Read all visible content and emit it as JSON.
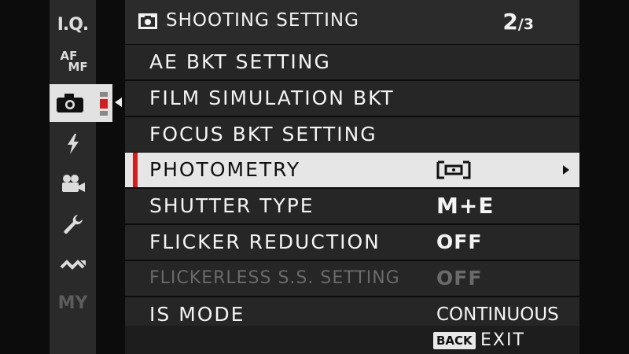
{
  "sidebar": {
    "items": [
      {
        "name": "image-quality",
        "label": "I.Q."
      },
      {
        "name": "af-mf",
        "label_top": "AF",
        "label_bottom": "MF"
      },
      {
        "name": "shooting-setting",
        "icon": "camera-icon",
        "selected": true
      },
      {
        "name": "flash",
        "icon": "flash-icon"
      },
      {
        "name": "movie",
        "icon": "movie-camera-icon"
      },
      {
        "name": "setup",
        "icon": "wrench-icon"
      },
      {
        "name": "connection",
        "icon": "wireless-wave-icon"
      },
      {
        "name": "my-menu",
        "label": "MY"
      }
    ]
  },
  "header": {
    "icon": "camera-icon",
    "title": "SHOOTING SETTING",
    "page_current": "2",
    "page_total": "/3"
  },
  "menu": {
    "rows": [
      {
        "label": "AE BKT SETTING",
        "value": ""
      },
      {
        "label": "FILM SIMULATION BKT",
        "value": ""
      },
      {
        "label": "FOCUS BKT SETTING",
        "value": ""
      },
      {
        "label": "PHOTOMETRY",
        "value_icon": "multi-metering-icon",
        "selected": true
      },
      {
        "label": "SHUTTER TYPE",
        "value": "M+E"
      },
      {
        "label": "FLICKER REDUCTION",
        "value": "OFF"
      },
      {
        "label": "FLICKERLESS S.S. SETTING",
        "value": "OFF",
        "disabled": true
      },
      {
        "label": "IS MODE",
        "value": "CONTINUOUS"
      }
    ]
  },
  "footer": {
    "back_label": "BACK",
    "exit_label": "EXIT"
  },
  "colors": {
    "accent_red": "#d21e1e",
    "selected_bg": "#e6e6e6",
    "row_bg": "#262626",
    "disabled_text": "#6a6a6a"
  }
}
